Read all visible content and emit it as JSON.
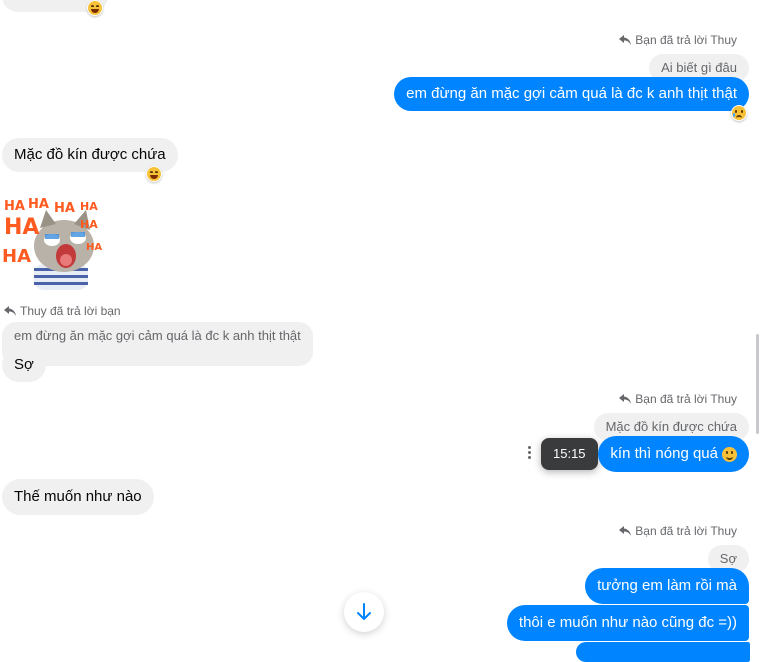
{
  "messages": {
    "m1_reply_note": "Bạn đã trả lời Thuy",
    "m1_quoted": "Ai biết gì đâu",
    "m1_text": "em đừng ăn mặc gợi cảm quá là đc k anh thịt thật",
    "m1_reaction": "sad-face-emoji",
    "m2_text": "Mặc đồ kín được chứa",
    "m2_reaction": "laughing-face-emoji",
    "m3_sticker": "cat-laughing-haha-sticker",
    "m4_reply_note": "Thuy đã trả lời bạn",
    "m4_quoted": "em đừng ăn mặc gợi cảm quá là đc k anh thịt thật",
    "m4_text": "Sợ",
    "m5_reply_note": "Bạn đã trả lời Thuy",
    "m5_quoted": "Mặc đồ kín được chứa",
    "m5_text": "kín thì nóng quá",
    "m5_tooltip": "15:15",
    "m6_text": "Thế muốn như nào",
    "m7_reply_note": "Bạn đã trả lời Thuy",
    "m7_quoted": "Sợ",
    "m7_text": "tưởng em làm rồi mà",
    "m8_text": "thôi e muốn như nào cũng đc =))"
  },
  "colors": {
    "outgoing": "#0084ff",
    "incoming": "#f0f0f0",
    "secondary_text": "#65676b"
  },
  "icons": {
    "reply": "reply-arrow-icon",
    "scroll_down": "arrow-down-icon",
    "more": "more-options-icon"
  }
}
